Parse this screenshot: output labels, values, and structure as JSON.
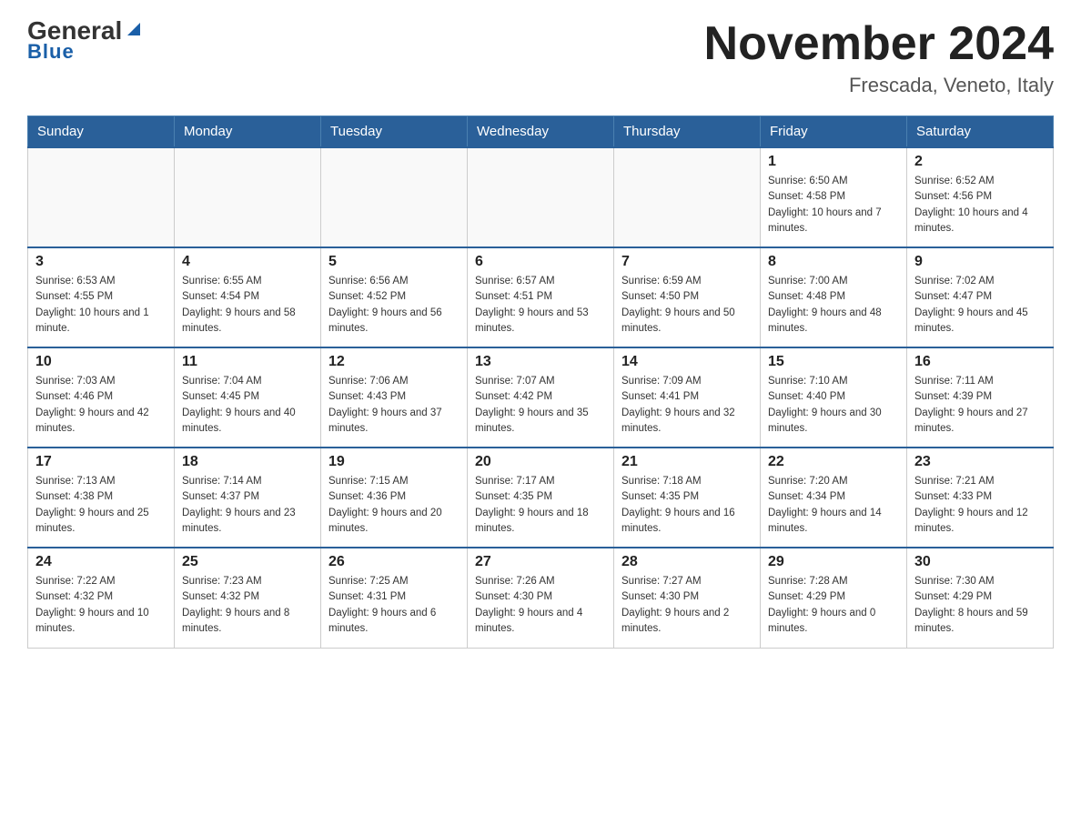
{
  "header": {
    "logo_main": "General",
    "logo_sub": "Blue",
    "month_year": "November 2024",
    "location": "Frescada, Veneto, Italy"
  },
  "days_of_week": [
    "Sunday",
    "Monday",
    "Tuesday",
    "Wednesday",
    "Thursday",
    "Friday",
    "Saturday"
  ],
  "weeks": [
    [
      {
        "day": "",
        "info": ""
      },
      {
        "day": "",
        "info": ""
      },
      {
        "day": "",
        "info": ""
      },
      {
        "day": "",
        "info": ""
      },
      {
        "day": "",
        "info": ""
      },
      {
        "day": "1",
        "info": "Sunrise: 6:50 AM\nSunset: 4:58 PM\nDaylight: 10 hours and 7 minutes."
      },
      {
        "day": "2",
        "info": "Sunrise: 6:52 AM\nSunset: 4:56 PM\nDaylight: 10 hours and 4 minutes."
      }
    ],
    [
      {
        "day": "3",
        "info": "Sunrise: 6:53 AM\nSunset: 4:55 PM\nDaylight: 10 hours and 1 minute."
      },
      {
        "day": "4",
        "info": "Sunrise: 6:55 AM\nSunset: 4:54 PM\nDaylight: 9 hours and 58 minutes."
      },
      {
        "day": "5",
        "info": "Sunrise: 6:56 AM\nSunset: 4:52 PM\nDaylight: 9 hours and 56 minutes."
      },
      {
        "day": "6",
        "info": "Sunrise: 6:57 AM\nSunset: 4:51 PM\nDaylight: 9 hours and 53 minutes."
      },
      {
        "day": "7",
        "info": "Sunrise: 6:59 AM\nSunset: 4:50 PM\nDaylight: 9 hours and 50 minutes."
      },
      {
        "day": "8",
        "info": "Sunrise: 7:00 AM\nSunset: 4:48 PM\nDaylight: 9 hours and 48 minutes."
      },
      {
        "day": "9",
        "info": "Sunrise: 7:02 AM\nSunset: 4:47 PM\nDaylight: 9 hours and 45 minutes."
      }
    ],
    [
      {
        "day": "10",
        "info": "Sunrise: 7:03 AM\nSunset: 4:46 PM\nDaylight: 9 hours and 42 minutes."
      },
      {
        "day": "11",
        "info": "Sunrise: 7:04 AM\nSunset: 4:45 PM\nDaylight: 9 hours and 40 minutes."
      },
      {
        "day": "12",
        "info": "Sunrise: 7:06 AM\nSunset: 4:43 PM\nDaylight: 9 hours and 37 minutes."
      },
      {
        "day": "13",
        "info": "Sunrise: 7:07 AM\nSunset: 4:42 PM\nDaylight: 9 hours and 35 minutes."
      },
      {
        "day": "14",
        "info": "Sunrise: 7:09 AM\nSunset: 4:41 PM\nDaylight: 9 hours and 32 minutes."
      },
      {
        "day": "15",
        "info": "Sunrise: 7:10 AM\nSunset: 4:40 PM\nDaylight: 9 hours and 30 minutes."
      },
      {
        "day": "16",
        "info": "Sunrise: 7:11 AM\nSunset: 4:39 PM\nDaylight: 9 hours and 27 minutes."
      }
    ],
    [
      {
        "day": "17",
        "info": "Sunrise: 7:13 AM\nSunset: 4:38 PM\nDaylight: 9 hours and 25 minutes."
      },
      {
        "day": "18",
        "info": "Sunrise: 7:14 AM\nSunset: 4:37 PM\nDaylight: 9 hours and 23 minutes."
      },
      {
        "day": "19",
        "info": "Sunrise: 7:15 AM\nSunset: 4:36 PM\nDaylight: 9 hours and 20 minutes."
      },
      {
        "day": "20",
        "info": "Sunrise: 7:17 AM\nSunset: 4:35 PM\nDaylight: 9 hours and 18 minutes."
      },
      {
        "day": "21",
        "info": "Sunrise: 7:18 AM\nSunset: 4:35 PM\nDaylight: 9 hours and 16 minutes."
      },
      {
        "day": "22",
        "info": "Sunrise: 7:20 AM\nSunset: 4:34 PM\nDaylight: 9 hours and 14 minutes."
      },
      {
        "day": "23",
        "info": "Sunrise: 7:21 AM\nSunset: 4:33 PM\nDaylight: 9 hours and 12 minutes."
      }
    ],
    [
      {
        "day": "24",
        "info": "Sunrise: 7:22 AM\nSunset: 4:32 PM\nDaylight: 9 hours and 10 minutes."
      },
      {
        "day": "25",
        "info": "Sunrise: 7:23 AM\nSunset: 4:32 PM\nDaylight: 9 hours and 8 minutes."
      },
      {
        "day": "26",
        "info": "Sunrise: 7:25 AM\nSunset: 4:31 PM\nDaylight: 9 hours and 6 minutes."
      },
      {
        "day": "27",
        "info": "Sunrise: 7:26 AM\nSunset: 4:30 PM\nDaylight: 9 hours and 4 minutes."
      },
      {
        "day": "28",
        "info": "Sunrise: 7:27 AM\nSunset: 4:30 PM\nDaylight: 9 hours and 2 minutes."
      },
      {
        "day": "29",
        "info": "Sunrise: 7:28 AM\nSunset: 4:29 PM\nDaylight: 9 hours and 0 minutes."
      },
      {
        "day": "30",
        "info": "Sunrise: 7:30 AM\nSunset: 4:29 PM\nDaylight: 8 hours and 59 minutes."
      }
    ]
  ]
}
